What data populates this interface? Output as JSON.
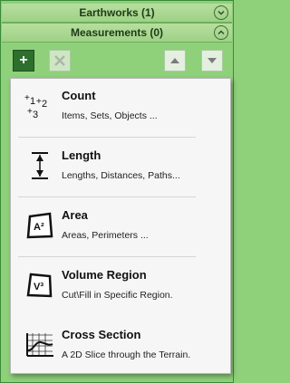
{
  "panels": {
    "earthworks_label": "Earthworks (1)",
    "measurements_label": "Measurements (0)"
  },
  "toolbar": {
    "add_symbol": "+"
  },
  "menu": {
    "items": [
      {
        "title": "Count",
        "desc": "Items, Sets, Objects ..."
      },
      {
        "title": "Length",
        "desc": "Lengths, Distances, Paths..."
      },
      {
        "title": "Area",
        "desc": "Areas, Perimeters ..."
      },
      {
        "title": "Volume Region",
        "desc": "Cut\\Fill in Specific Region."
      },
      {
        "title": "Cross Section",
        "desc": "A 2D Slice through the Terrain."
      }
    ],
    "icons": {
      "count_digits": [
        "1",
        "2",
        "3"
      ],
      "area_label": "A²",
      "volume_label": "V³"
    }
  },
  "colors": {
    "panel_bg": "#8fd07a",
    "header_bg": "#a6d58f",
    "add_button": "#2d6f2d"
  }
}
